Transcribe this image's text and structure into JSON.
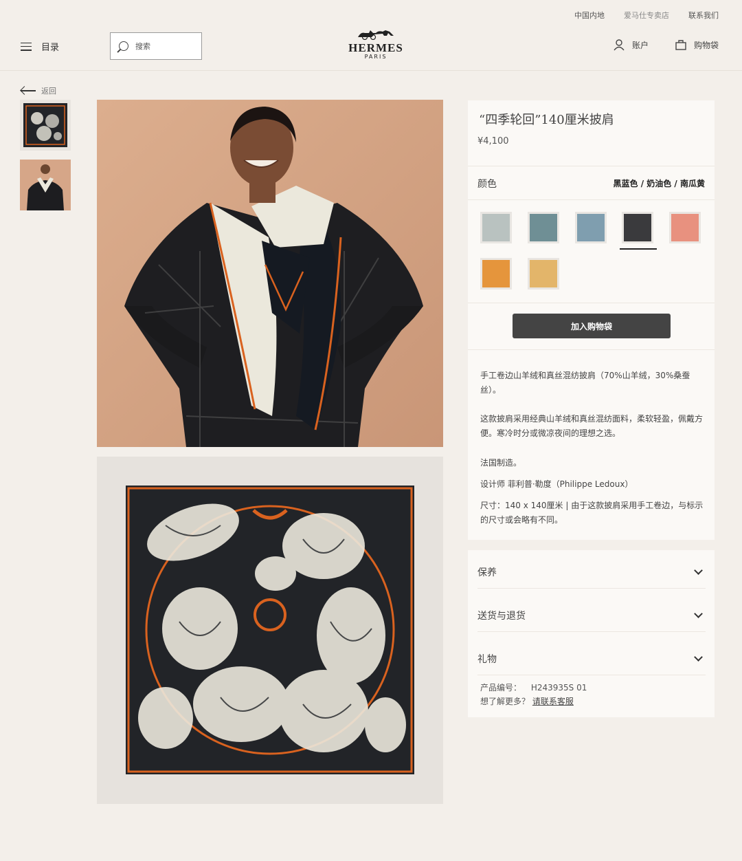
{
  "utility_links": [
    "中国内地",
    "爱马仕专卖店",
    "联系我们"
  ],
  "header": {
    "menu_label": "目录",
    "search_placeholder": "搜索",
    "logo_brand": "HERMES",
    "logo_city": "PARIS",
    "account_label": "账户",
    "bag_label": "购物袋"
  },
  "back_label": "返回",
  "product": {
    "title": "“四季轮回”140厘米披肩",
    "price": "¥4,100",
    "color_label": "颜色",
    "color_value": "黑蓝色 / 奶油色 / 南瓜黄",
    "swatches": [
      {
        "name": "swatch-1",
        "color": "#b9c2c0"
      },
      {
        "name": "swatch-2",
        "color": "#6f8f95"
      },
      {
        "name": "swatch-3",
        "color": "#7f9eaf"
      },
      {
        "name": "swatch-4",
        "color": "#3a3a3d",
        "selected": true
      },
      {
        "name": "swatch-5",
        "color": "#e8917f"
      },
      {
        "name": "swatch-6",
        "color": "#e5953c"
      },
      {
        "name": "swatch-7",
        "color": "#e3b56a"
      }
    ],
    "add_to_bag": "加入购物袋",
    "desc1": "手工卷边山羊绒和真丝混纺披肩（70%山羊绒，30%桑蚕丝）。",
    "desc2": "这款披肩采用经典山羊绒和真丝混纺面料，柔软轻盈，佩戴方便。寒冷时分或微凉夜间的理想之选。",
    "desc3": "法国制造。",
    "desc4": "设计师 菲利普·勒度（Philippe Ledoux）",
    "desc5": "尺寸：140 x 140厘米 | 由于这款披肩采用手工卷边，与标示的尺寸或会略有不同。"
  },
  "accordion": [
    "保养",
    "送货与退货",
    "礼物"
  ],
  "reference": {
    "label": "产品编号：",
    "value": "H243935S 01",
    "more": "想了解更多？",
    "contact_link": "请联系客服"
  },
  "colors": {
    "background": "#f3efea",
    "panel": "#fbf9f6",
    "button": "#444444",
    "scarf_black": "#222428",
    "scarf_orange": "#d9621f",
    "scarf_cream": "#ebe8dc"
  }
}
